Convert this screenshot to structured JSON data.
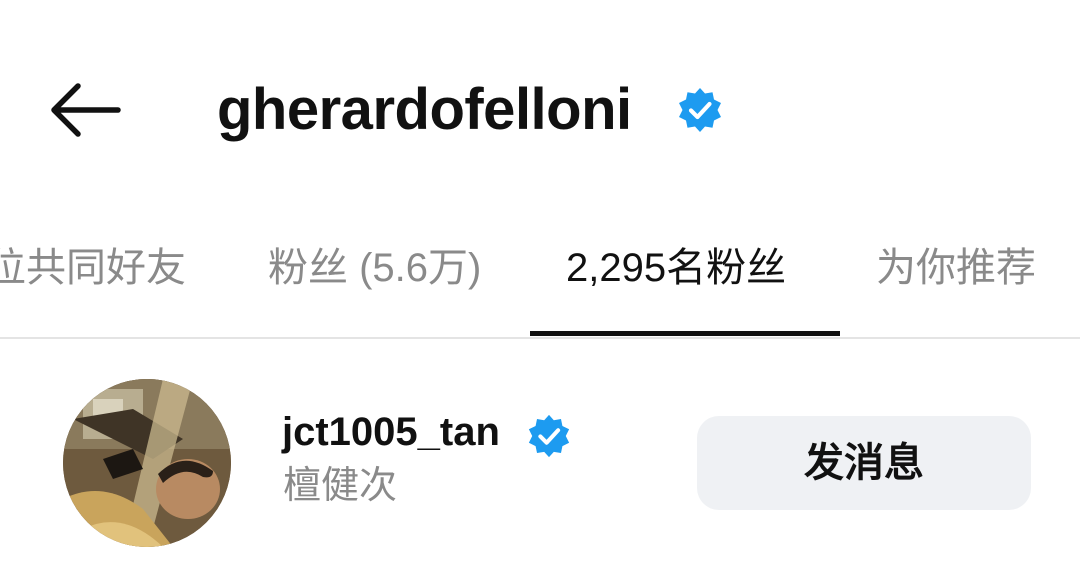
{
  "header": {
    "back_icon": "arrow-left-icon",
    "username": "gherardofelloni",
    "verified_icon": "verified-badge-icon"
  },
  "tabs": [
    {
      "label": "位共同好友",
      "active": false
    },
    {
      "label": "粉丝 (5.6万)",
      "active": false
    },
    {
      "label": "2,295名粉丝",
      "active": true
    },
    {
      "label": "为你推荐",
      "active": false
    }
  ],
  "list": [
    {
      "username": "jct1005_tan",
      "full_name": "檀健次",
      "verified_icon": "verified-badge-icon",
      "action_label": "发消息"
    }
  ],
  "colors": {
    "verified": "#1d9bf0",
    "text_primary": "#111111",
    "text_secondary": "#8a8a8a",
    "button_bg": "#eff1f4",
    "divider": "#e4e4e4"
  }
}
